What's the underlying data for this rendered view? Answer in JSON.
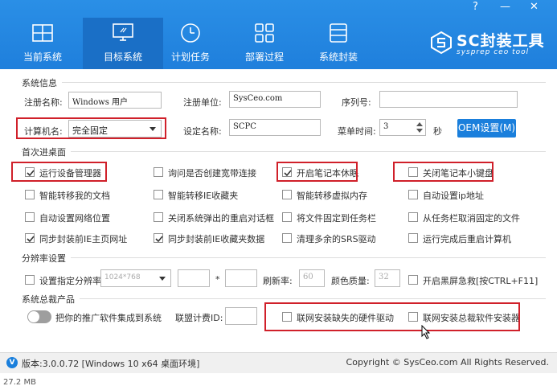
{
  "window": {
    "help": "?",
    "minimize": "—",
    "close": "✕"
  },
  "tabs": [
    {
      "label": "当前系统",
      "icon": "windows-icon"
    },
    {
      "label": "目标系统",
      "icon": "monitor-icon"
    },
    {
      "label": "计划任务",
      "icon": "clock-icon"
    },
    {
      "label": "部署过程",
      "icon": "grid-icon"
    },
    {
      "label": "系统封装",
      "icon": "package-icon"
    }
  ],
  "logo": {
    "title": "SC封装工具",
    "subtitle": "sysprep ceo tool"
  },
  "system_info": {
    "section": "系统信息",
    "reg_name_label": "注册名称:",
    "reg_name_value": "Windows 用户",
    "reg_org_label": "注册单位:",
    "reg_org_value": "SysCeo.com",
    "serial_label": "序列号:",
    "serial_value": "",
    "computer_name_label": "计算机名:",
    "computer_name_value": "完全固定",
    "setting_name_label": "设定名称:",
    "setting_name_value": "SCPC",
    "menu_time_label": "菜单时间:",
    "menu_time_value": "3",
    "menu_time_unit": "秒",
    "oem_button": "OEM设置(M)"
  },
  "desktop": {
    "section": "首次进桌面",
    "rows": [
      [
        {
          "label": "运行设备管理器",
          "checked": true
        },
        {
          "label": "询问是否创建宽带连接",
          "checked": false
        },
        {
          "label": "开启笔记本休眠",
          "checked": true
        },
        {
          "label": "关闭笔记本小键盘",
          "checked": false
        }
      ],
      [
        {
          "label": "智能转移我的文档",
          "checked": false
        },
        {
          "label": "智能转移IE收藏夹",
          "checked": false
        },
        {
          "label": "智能转移虚拟内存",
          "checked": false
        },
        {
          "label": "自动设置ip地址",
          "checked": false
        }
      ],
      [
        {
          "label": "自动设置网络位置",
          "checked": false
        },
        {
          "label": "关闭系统弹出的重启对话框",
          "checked": false
        },
        {
          "label": "将文件固定到任务栏",
          "checked": false
        },
        {
          "label": "从任务栏取消固定的文件",
          "checked": false
        }
      ],
      [
        {
          "label": "同步封装前IE主页网址",
          "checked": true
        },
        {
          "label": "同步封装前IE收藏夹数据",
          "checked": true
        },
        {
          "label": "清理多余的SRS驱动",
          "checked": false
        },
        {
          "label": "运行完成后重启计算机",
          "checked": false
        }
      ]
    ]
  },
  "resolution": {
    "section": "分辨率设置",
    "set_label": "设置指定分辨率",
    "set_checked": false,
    "res_value": "1024*768",
    "times": "*",
    "refresh_label": "刷新率:",
    "refresh_value": "60",
    "color_label": "颜色质量:",
    "color_value": "32",
    "black_screen_label": "开启黑屏急救[按CTRL+F11]",
    "black_screen_checked": false
  },
  "products": {
    "section": "系统总裁产品",
    "toggle_label": "把你的推广软件集成到系统",
    "toggle_on": false,
    "union_label": "联盟计费ID:",
    "union_value": "",
    "hw_driver_label": "联网安装缺失的硬件驱动",
    "hw_driver_checked": false,
    "installer_label": "联网安装总裁软件安装器",
    "installer_checked": false
  },
  "footer": {
    "version": "版本:3.0.0.72 [Windows 10 x64 桌面环境]",
    "copyright": "Copyright © SysCeo.com All Rights Reserved."
  },
  "below": {
    "size_text": "27.2 MB"
  }
}
